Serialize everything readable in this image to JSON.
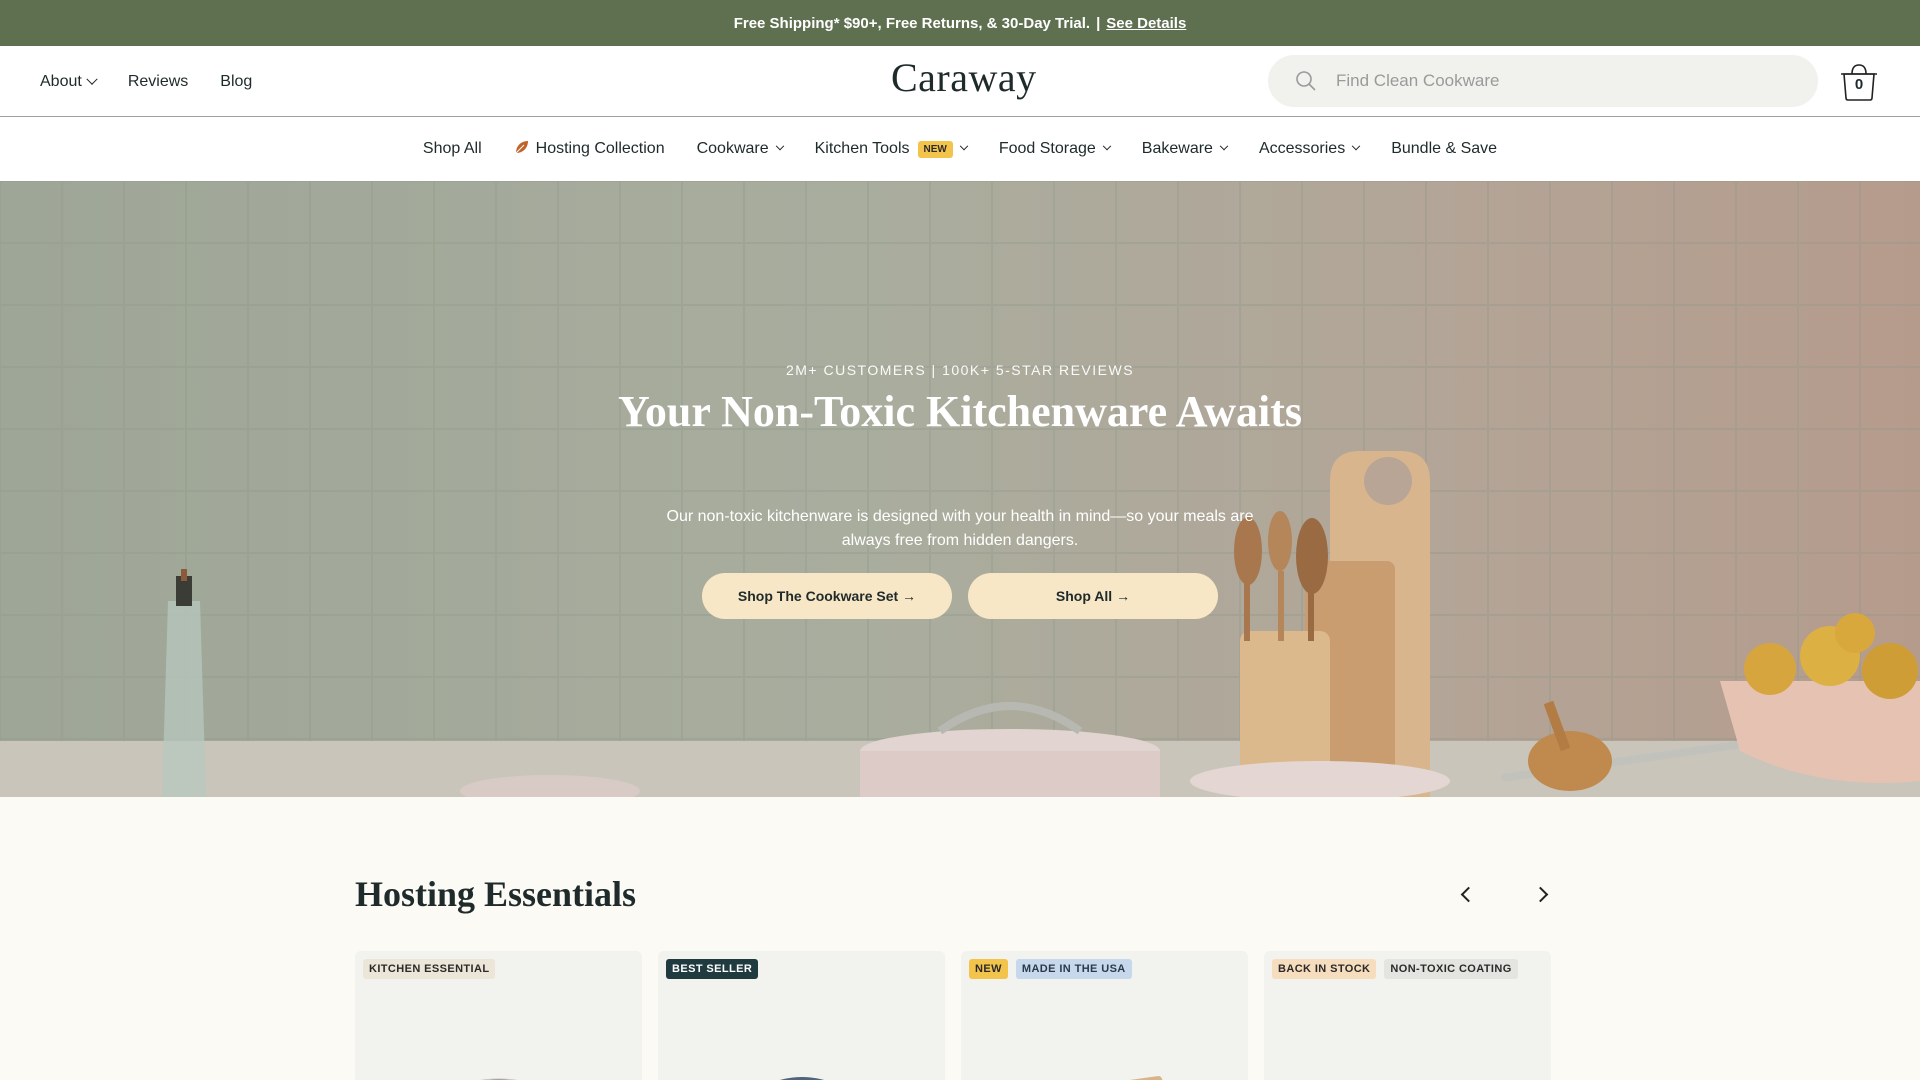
{
  "announcement": {
    "text": "Free Shipping* $90+, Free Returns, & 30-Day Trial.",
    "separator": "|",
    "link": "See Details"
  },
  "header": {
    "util_nav": [
      {
        "label": "About",
        "has_dropdown": true
      },
      {
        "label": "Reviews"
      },
      {
        "label": "Blog"
      }
    ],
    "logo": "Caraway",
    "search": {
      "placeholder": "Find Clean Cookware",
      "icon": "search-icon"
    },
    "cart": {
      "count": "0",
      "icon": "cart-icon"
    }
  },
  "category_nav": [
    {
      "label": "Shop All"
    },
    {
      "label": "Hosting Collection",
      "icon": "leaf-icon"
    },
    {
      "label": "Cookware",
      "has_dropdown": true
    },
    {
      "label": "Kitchen Tools",
      "badge": "NEW",
      "has_dropdown": true
    },
    {
      "label": "Food Storage",
      "has_dropdown": true
    },
    {
      "label": "Bakeware",
      "has_dropdown": true
    },
    {
      "label": "Accessories",
      "has_dropdown": true
    },
    {
      "label": "Bundle & Save"
    }
  ],
  "hero": {
    "eyebrow": "2M+ CUSTOMERS | 100K+ 5-STAR REVIEWS",
    "title": "Your Non-Toxic Kitchenware Awaits",
    "subtitle": "Our non-toxic kitchenware is designed with your health in mind—so your meals are always free from hidden dangers.",
    "buttons": [
      "Shop The Cookware Set →",
      "Shop All →"
    ]
  },
  "section": {
    "title": "Hosting Essentials",
    "prev_icon": "chevron-left-icon",
    "next_icon": "chevron-right-icon",
    "cards": [
      {
        "tags": [
          {
            "text": "KITCHEN ESSENTIAL",
            "color": "#ece6d8"
          }
        ]
      },
      {
        "tags": [
          {
            "text": "BEST SELLER",
            "color": "#1f3b40"
          }
        ]
      },
      {
        "tags": [
          {
            "text": "NEW",
            "color": "#f3c44c"
          },
          {
            "text": "MADE IN THE USA",
            "color": "#c8d8ec"
          }
        ]
      },
      {
        "tags": [
          {
            "text": "BACK IN STOCK",
            "color": "#f6ddbd"
          },
          {
            "text": "NON-TOXIC COATING",
            "color": "#e4e4e0"
          }
        ]
      }
    ]
  },
  "colors": {
    "announcement_bg": "#5f7050",
    "button_bg": "#f8e7c6",
    "text_dark": "#1f2a2b",
    "page_bg": "#fbfaf5"
  }
}
